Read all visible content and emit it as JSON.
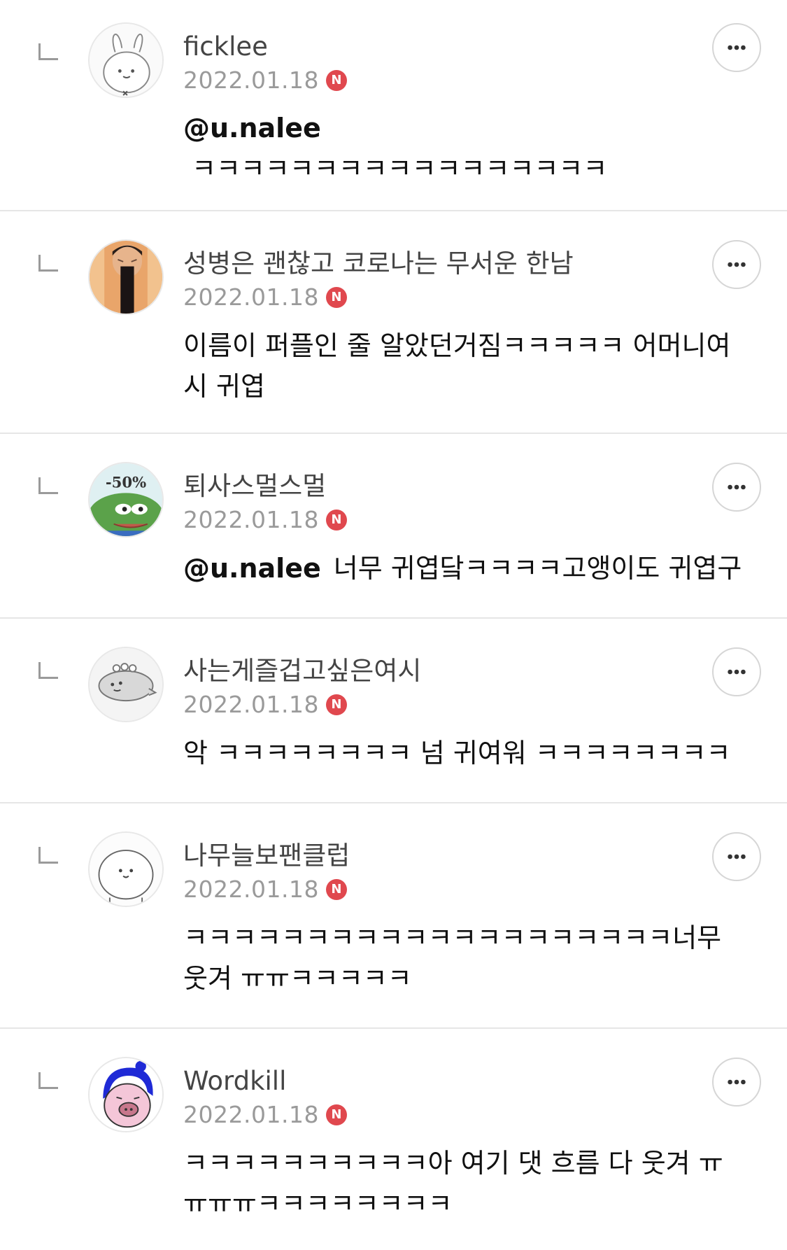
{
  "comments": [
    {
      "nickname": "ficklee",
      "date": "2022.01.18",
      "badge": "N",
      "mention": "@u.nalee",
      "text": "ㅋㅋㅋㅋㅋㅋㅋㅋㅋㅋㅋㅋㅋㅋㅋㅋㅋ",
      "avatar_icon": "rabbit-avatar-icon"
    },
    {
      "nickname": "성병은 괜찮고 코로나는 무서운 한남",
      "date": "2022.01.18",
      "badge": "N",
      "mention": "",
      "text": "이름이 퍼플인 줄 알았던거짐ㅋㅋㅋㅋㅋ 어머니여시 귀엽",
      "avatar_icon": "person-photo-avatar-icon"
    },
    {
      "nickname": "퇴사스멀스멀",
      "date": "2022.01.18",
      "badge": "N",
      "mention": "@u.nalee",
      "text": "너무 귀엽닼ㅋㅋㅋㅋ고앵이도 귀엽구",
      "avatar_icon": "frog-sale-avatar-icon",
      "avatar_text": "-50%"
    },
    {
      "nickname": "사는게즐겁고싶은여시",
      "date": "2022.01.18",
      "badge": "N",
      "mention": "",
      "text": "악 ㅋㅋㅋㅋㅋㅋㅋㅋ 넘 귀여워 ㅋㅋㅋㅋㅋㅋㅋㅋ",
      "avatar_icon": "seal-avatar-icon"
    },
    {
      "nickname": "나무늘보팬클럽",
      "date": "2022.01.18",
      "badge": "N",
      "mention": "",
      "text": "ㅋㅋㅋㅋㅋㅋㅋㅋㅋㅋㅋㅋㅋㅋㅋㅋㅋㅋㅋㅋ너무웃겨 ㅠㅠㅋㅋㅋㅋㅋ",
      "avatar_icon": "round-creature-avatar-icon"
    },
    {
      "nickname": "Wordkill",
      "date": "2022.01.18",
      "badge": "N",
      "mention": "",
      "text": "ㅋㅋㅋㅋㅋㅋㅋㅋㅋㅋ아 여기 댓 흐름 다 웃겨 ㅠㅠㅠㅠㅋㅋㅋㅋㅋㅋㅋㅋ",
      "avatar_icon": "pig-blue-hair-avatar-icon"
    }
  ],
  "colors": {
    "badge": "#e0484e",
    "divider": "#e6e6e6",
    "date": "#9a9a9a"
  }
}
